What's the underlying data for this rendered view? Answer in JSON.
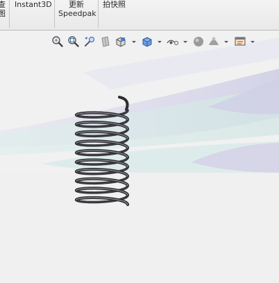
{
  "ribbon": {
    "partial_label_line1": "查",
    "partial_label_line2": "图",
    "instant3d_label": "Instant3D",
    "update_speedpak_line1": "更新",
    "update_speedpak_line2": "Speedpak",
    "snapshot_label": "拍快照"
  },
  "heads_up_toolbar": {
    "icons": [
      "zoom-to-fit-icon",
      "zoom-to-area-icon",
      "previous-view-icon",
      "section-view-icon",
      "view-orientation-icon",
      "display-style-icon",
      "hide-show-items-icon",
      "edit-appearance-icon",
      "apply-scene-icon",
      "view-settings-icon"
    ]
  },
  "colors": {
    "ribbon_bg": "#eeeeee",
    "viewport_bg": "#f1f1f1",
    "scene_lavender": "#dcdcec",
    "scene_teal": "#dbe9e9",
    "spring_dark": "#3b3b40",
    "spring_light": "#9a9aa0"
  }
}
